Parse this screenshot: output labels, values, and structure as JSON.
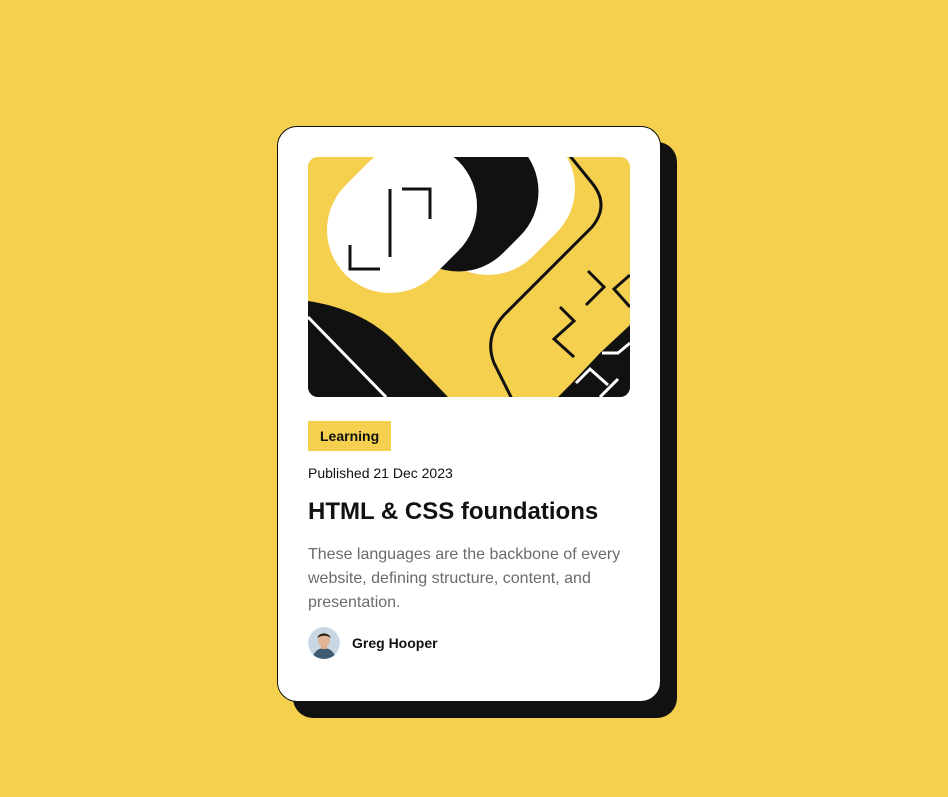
{
  "card": {
    "tag": "Learning",
    "published": "Published 21 Dec 2023",
    "title": "HTML & CSS foundations",
    "description": "These languages are the backbone of every website, defining structure, content, and presentation.",
    "author": {
      "name": "Greg Hooper"
    }
  },
  "colors": {
    "background": "#f4d04e",
    "card": "#ffffff",
    "ink": "#111111",
    "muted_text": "#6b6b6b"
  },
  "icons": {
    "hero": "abstract-illustration",
    "avatar": "author-avatar"
  }
}
